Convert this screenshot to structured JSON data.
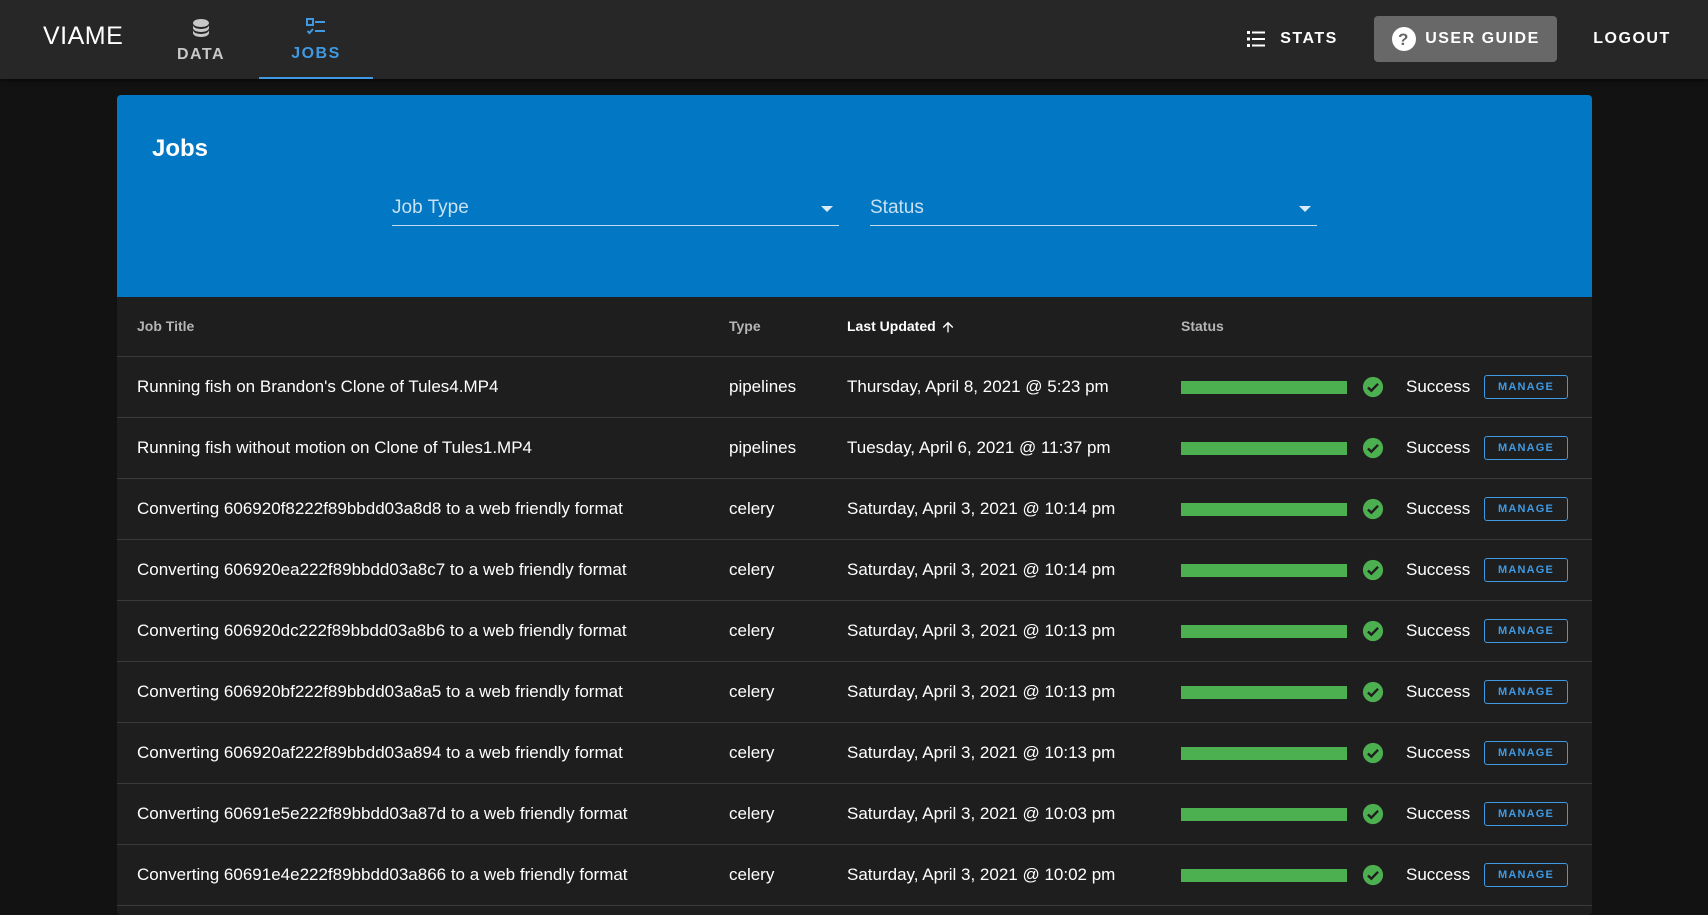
{
  "app": {
    "title": "VIAME"
  },
  "nav": {
    "tabs": [
      {
        "label": "DATA",
        "icon": "database-icon",
        "active": false
      },
      {
        "label": "JOBS",
        "icon": "job-list-icon",
        "active": true
      }
    ],
    "active_color": "#3f9ae3"
  },
  "toolbar": {
    "stats_label": "STATS",
    "guide_label": "USER GUIDE",
    "logout_label": "LOGOUT"
  },
  "panel": {
    "title": "Jobs",
    "header_color": "#0277c3",
    "filters": {
      "job_type": "Job Type",
      "status": "Status"
    }
  },
  "table": {
    "columns": {
      "title": "Job Title",
      "type": "Type",
      "updated": "Last Updated",
      "status": "Status"
    },
    "sort": {
      "column": "Last Updated",
      "direction": "ascending-arrow-icon"
    },
    "manage_label": "MANAGE",
    "success_color": "#4caf50",
    "rows": [
      {
        "title": "Running fish on Brandon's Clone of Tules4.MP4",
        "type": "pipelines",
        "updated": "Thursday, April 8, 2021 @ 5:23 pm",
        "progress": 1.0,
        "status": "Success"
      },
      {
        "title": "Running fish without motion on Clone of Tules1.MP4",
        "type": "pipelines",
        "updated": "Tuesday, April 6, 2021 @ 11:37 pm",
        "progress": 1.0,
        "status": "Success"
      },
      {
        "title": "Converting 606920f8222f89bbdd03a8d8 to a web friendly format",
        "type": "celery",
        "updated": "Saturday, April 3, 2021 @ 10:14 pm",
        "progress": 1.0,
        "status": "Success"
      },
      {
        "title": "Converting 606920ea222f89bbdd03a8c7 to a web friendly format",
        "type": "celery",
        "updated": "Saturday, April 3, 2021 @ 10:14 pm",
        "progress": 1.0,
        "status": "Success"
      },
      {
        "title": "Converting 606920dc222f89bbdd03a8b6 to a web friendly format",
        "type": "celery",
        "updated": "Saturday, April 3, 2021 @ 10:13 pm",
        "progress": 1.0,
        "status": "Success"
      },
      {
        "title": "Converting 606920bf222f89bbdd03a8a5 to a web friendly format",
        "type": "celery",
        "updated": "Saturday, April 3, 2021 @ 10:13 pm",
        "progress": 1.0,
        "status": "Success"
      },
      {
        "title": "Converting 606920af222f89bbdd03a894 to a web friendly format",
        "type": "celery",
        "updated": "Saturday, April 3, 2021 @ 10:13 pm",
        "progress": 1.0,
        "status": "Success"
      },
      {
        "title": "Converting 60691e5e222f89bbdd03a87d to a web friendly format",
        "type": "celery",
        "updated": "Saturday, April 3, 2021 @ 10:03 pm",
        "progress": 1.0,
        "status": "Success"
      },
      {
        "title": "Converting 60691e4e222f89bbdd03a866 to a web friendly format",
        "type": "celery",
        "updated": "Saturday, April 3, 2021 @ 10:02 pm",
        "progress": 1.0,
        "status": "Success"
      }
    ]
  }
}
